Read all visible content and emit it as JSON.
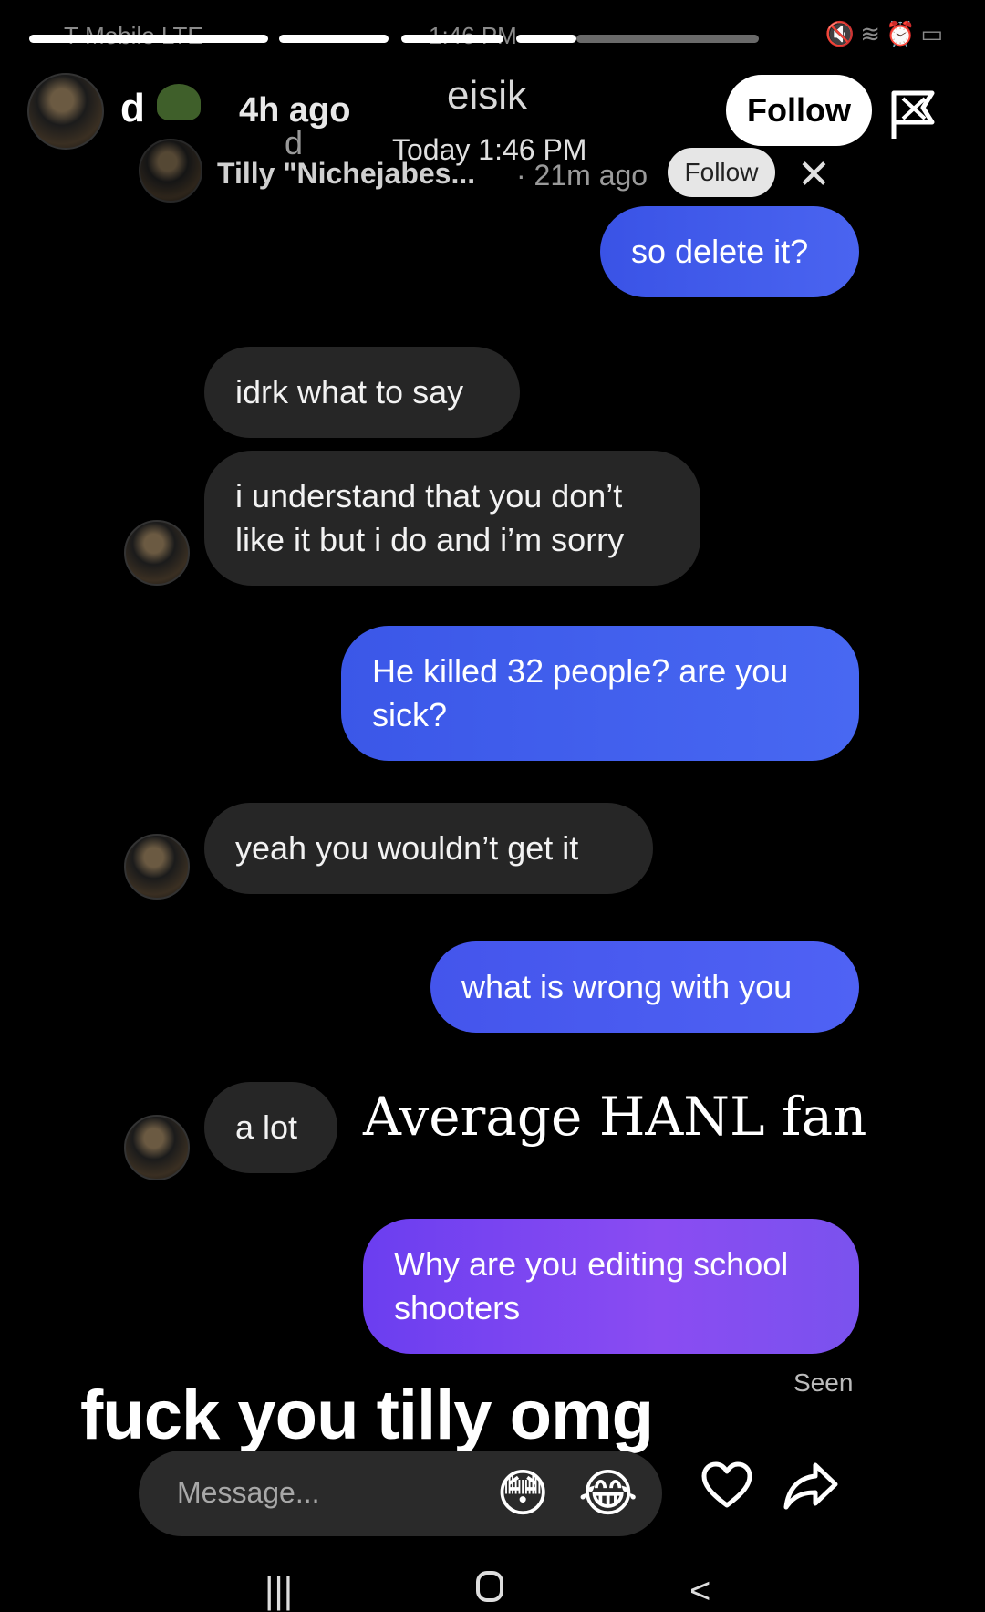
{
  "status_bar": {
    "carrier": "T-Mobile LTE",
    "time": "1:46 PM",
    "icons": [
      "mute-icon",
      "wifi-icon",
      "signal-icon",
      "alarm-icon",
      "battery-icon"
    ]
  },
  "story": {
    "progress_segments": 4,
    "username": "d",
    "time_ago": "4h ago",
    "follow_label": "Follow",
    "icons": [
      "helmet-icon",
      "flag-icon"
    ]
  },
  "dm_header": {
    "title": "eisik",
    "subtitle": "Today 1:46 PM",
    "user_initial": "d",
    "contact_name": "Tilly \"Nichejabes...",
    "time_ago": "· 21m ago",
    "follow_label": "Follow"
  },
  "messages": [
    {
      "side": "out",
      "text": "so delete it?"
    },
    {
      "side": "in",
      "text": "idrk what to say"
    },
    {
      "side": "in",
      "text": "i understand that you don’t like it but i do and i’m sorry"
    },
    {
      "side": "out",
      "text": "He killed 32 people? are you sick?"
    },
    {
      "side": "in",
      "text": "yeah you wouldn’t get it"
    },
    {
      "side": "out",
      "text": "what is wrong with you"
    },
    {
      "side": "in",
      "text": "a lot"
    },
    {
      "side": "out",
      "text": "Why are you editing school shooters"
    }
  ],
  "overlay": {
    "serif_text": "Average HANL fan",
    "caption": "fuck you tilly omg"
  },
  "seen_label": "Seen",
  "composer": {
    "placeholder": "Message...",
    "emojis": [
      "😳",
      "😂"
    ]
  },
  "colors": {
    "background": "#000000",
    "incoming_bubble": "#262626",
    "outgoing_blue": "#4a64f0",
    "outgoing_purple": "#8a4cf2"
  },
  "nav_icons": [
    "recents-icon",
    "home-icon",
    "back-icon"
  ]
}
